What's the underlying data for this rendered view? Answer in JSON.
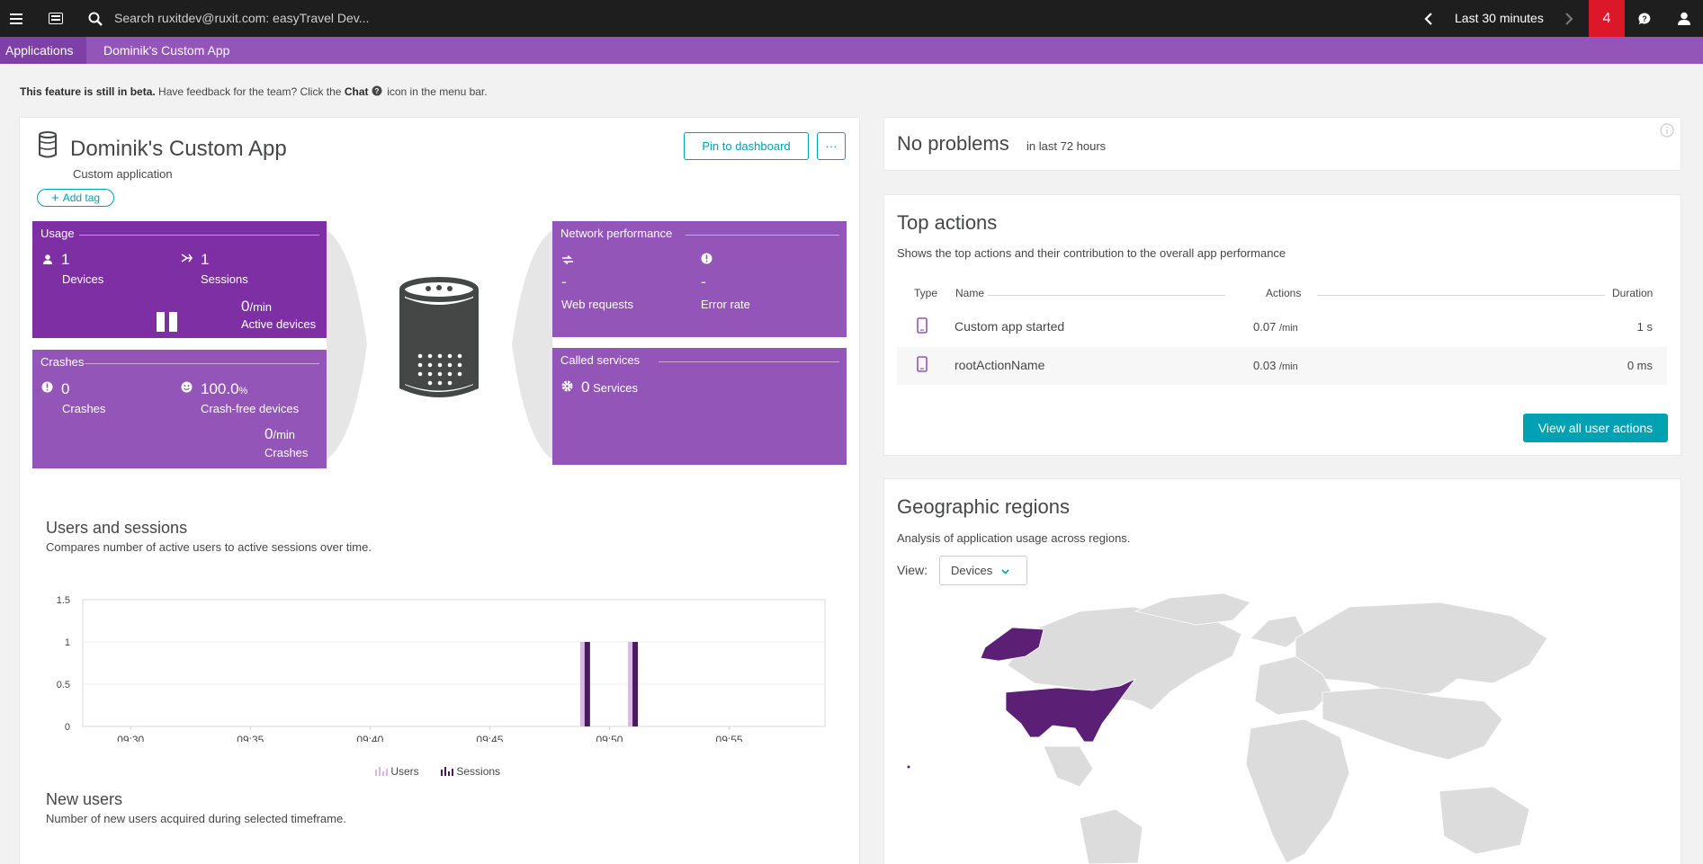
{
  "topbar": {
    "menu_icon": "hamburger-menu-icon",
    "dashboard_icon": "dashboard-icon",
    "search_icon": "search-icon",
    "search_placeholder": "Search ruxitdev@ruxit.com: easyTravel Dev...",
    "timeframe": "Last 30 minutes",
    "problems_count": "4",
    "chat_icon": "chat-icon",
    "user_icon": "user-icon"
  },
  "breadcrumb": {
    "root": "Applications",
    "current": "Dominik's Custom App"
  },
  "beta_notice": {
    "bold": "This feature is still in beta.",
    "text1": "Have feedback for the team? Click the",
    "chat_word": "Chat",
    "text2": "icon in the menu bar."
  },
  "app": {
    "title": "Dominik's Custom App",
    "subtitle": "Custom application",
    "add_tag": "Add tag",
    "pin_button": "Pin to dashboard",
    "more_button": "···"
  },
  "usage": {
    "title": "Usage",
    "devices_value": "1",
    "devices_label": "Devices",
    "sessions_value": "1",
    "sessions_label": "Sessions",
    "rate_value": "0",
    "rate_unit": "/min",
    "rate_label": "Active devices"
  },
  "crashes": {
    "title": "Crashes",
    "crashes_value": "0",
    "crashes_label": "Crashes",
    "crashfree_value": "100.0",
    "crashfree_unit": "%",
    "crashfree_label": "Crash-free devices",
    "rate_value": "0",
    "rate_unit": "/min",
    "rate_label": "Crashes"
  },
  "network": {
    "title": "Network performance",
    "web_value": "-",
    "web_label": "Web requests",
    "error_value": "-",
    "error_label": "Error rate"
  },
  "called_services": {
    "title": "Called services",
    "value": "0",
    "label": "Services"
  },
  "users_sessions": {
    "title": "Users and sessions",
    "subtitle": "Compares number of active users to active sessions over time.",
    "legend_users": "Users",
    "legend_sessions": "Sessions"
  },
  "chart_data": {
    "type": "bar",
    "x_ticks": [
      "09:30",
      "09:35",
      "09:40",
      "09:45",
      "09:50",
      "09:55"
    ],
    "y_ticks": [
      "1.5",
      "1",
      "0.5",
      "0"
    ],
    "ylim": [
      0,
      1.5
    ],
    "x_range": [
      "09:28",
      "09:59"
    ],
    "x": [
      "09:49",
      "09:51"
    ],
    "series": [
      {
        "name": "Users",
        "values": [
          1,
          1
        ],
        "color": "#d9b7e6"
      },
      {
        "name": "Sessions",
        "values": [
          1,
          1
        ],
        "color": "#4b1a5e"
      }
    ],
    "legend_position": "bottom",
    "grid": true
  },
  "new_users": {
    "title": "New users",
    "subtitle": "Number of new users acquired during selected timeframe."
  },
  "problems_panel": {
    "title": "No problems",
    "subtitle": "in last 72 hours",
    "info_icon": "info-icon"
  },
  "top_actions": {
    "title": "Top actions",
    "subtitle": "Shows the top actions and their contribution to the overall app performance",
    "col_type": "Type",
    "col_name": "Name",
    "col_actions": "Actions",
    "col_duration": "Duration",
    "rows": [
      {
        "name": "Custom app started",
        "actions": "0.07",
        "unit": "/min",
        "duration": "1 s"
      },
      {
        "name": "rootActionName",
        "actions": "0.03",
        "unit": "/min",
        "duration": "0 ms"
      }
    ],
    "view_all": "View all user actions"
  },
  "geo": {
    "title": "Geographic regions",
    "subtitle": "Analysis of application usage across regions.",
    "view_label": "View:",
    "view_value": "Devices"
  },
  "colors": {
    "accent": "#00a1b2",
    "brand": "#9355b7",
    "tile_dark": "#7e2fa3",
    "tile": "#9355b7",
    "problem": "#dc172a"
  }
}
